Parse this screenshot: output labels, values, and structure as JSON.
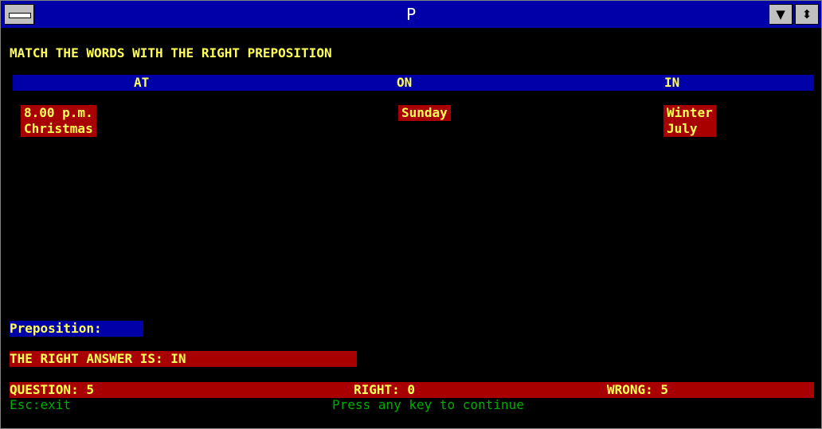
{
  "window": {
    "title": "P"
  },
  "instruction": "MATCH THE WORDS WITH THE RIGHT PREPOSITION",
  "columns": [
    {
      "heading": "AT",
      "words": [
        "8.00 p.m.",
        "Christmas"
      ]
    },
    {
      "heading": "ON",
      "words": [
        "Sunday"
      ]
    },
    {
      "heading": "IN",
      "words": [
        "Winter",
        "July"
      ]
    }
  ],
  "prompt_label": "Preposition:",
  "answer_text": "THE RIGHT ANSWER IS: IN",
  "status": {
    "question": "QUESTION: 5",
    "right": "RIGHT: 0",
    "wrong": "WRONG: 5"
  },
  "footer": {
    "exit_hint": "Esc:exit",
    "continue_hint": "Press any key to continue"
  },
  "colors": {
    "title_bar": "#0000a8",
    "text_yellow": "#ffff55",
    "text_green": "#00aa00",
    "red_band": "#a80000",
    "blue_band": "#0000a8"
  },
  "icons": [
    "system-menu-icon",
    "minimize-icon",
    "restore-icon"
  ]
}
